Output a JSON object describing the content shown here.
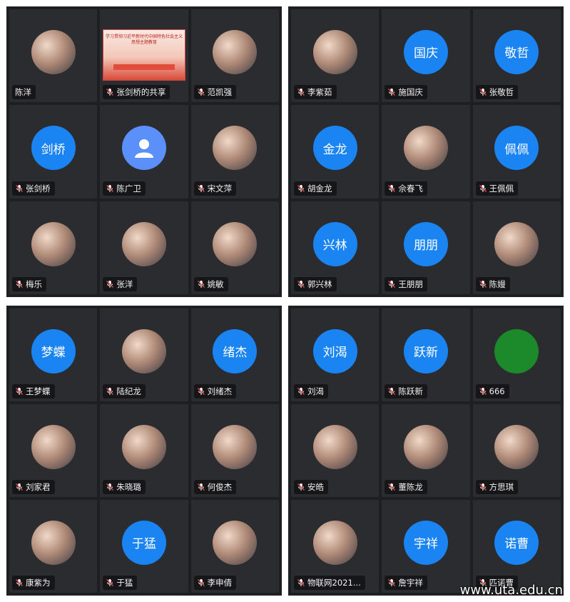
{
  "watermark": "www.uta.edu.cn",
  "colors": {
    "panel_bg": "#1e1f21",
    "tile_bg": "#2b2c2f",
    "avatar_blue": "#1a84f2",
    "mic_muted_red": "#e0443e"
  },
  "shared_screen": {
    "title": "学习贯彻习近平新时代中国特色社会主义思想主题教育"
  },
  "panels": [
    {
      "tiles": [
        {
          "name": "陈洋",
          "avatar": "photo",
          "muted": false
        },
        {
          "name": "张剑桥的共享",
          "avatar": "shared",
          "muted": true
        },
        {
          "name": "范凯强",
          "avatar": "photo",
          "muted": true
        },
        {
          "name": "张剑桥",
          "avatar": "text",
          "avatar_text": "剑桥",
          "muted": true
        },
        {
          "name": "陈广卫",
          "avatar": "default",
          "muted": true
        },
        {
          "name": "宋文萍",
          "avatar": "photo",
          "muted": true
        },
        {
          "name": "梅乐",
          "avatar": "photo",
          "muted": true
        },
        {
          "name": "张洋",
          "avatar": "photo",
          "muted": true
        },
        {
          "name": "姚敏",
          "avatar": "photo",
          "muted": true
        }
      ]
    },
    {
      "tiles": [
        {
          "name": "李紫茹",
          "avatar": "photo",
          "muted": true
        },
        {
          "name": "施国庆",
          "avatar": "text",
          "avatar_text": "国庆",
          "muted": true
        },
        {
          "name": "张敬哲",
          "avatar": "text",
          "avatar_text": "敬哲",
          "muted": true
        },
        {
          "name": "胡金龙",
          "avatar": "text",
          "avatar_text": "金龙",
          "muted": true
        },
        {
          "name": "佘春飞",
          "avatar": "photo",
          "muted": true
        },
        {
          "name": "王佩佩",
          "avatar": "text",
          "avatar_text": "佩佩",
          "muted": true
        },
        {
          "name": "郭兴林",
          "avatar": "text",
          "avatar_text": "兴林",
          "muted": true
        },
        {
          "name": "王朋朋",
          "avatar": "text",
          "avatar_text": "朋朋",
          "muted": true
        },
        {
          "name": "陈嫚",
          "avatar": "photo",
          "muted": true
        }
      ]
    },
    {
      "tiles": [
        {
          "name": "王梦蝶",
          "avatar": "text",
          "avatar_text": "梦蝶",
          "muted": true
        },
        {
          "name": "陆纪龙",
          "avatar": "photo",
          "muted": true
        },
        {
          "name": "刘绪杰",
          "avatar": "text",
          "avatar_text": "绪杰",
          "muted": true
        },
        {
          "name": "刘家君",
          "avatar": "photo",
          "muted": true
        },
        {
          "name": "朱晓璐",
          "avatar": "photo",
          "muted": true
        },
        {
          "name": "何俊杰",
          "avatar": "photo",
          "muted": true
        },
        {
          "name": "康紫为",
          "avatar": "photo",
          "muted": true
        },
        {
          "name": "于猛",
          "avatar": "text",
          "avatar_text": "于猛",
          "muted": true
        },
        {
          "name": "李申倩",
          "avatar": "photo",
          "muted": true
        }
      ]
    },
    {
      "tiles": [
        {
          "name": "刘渴",
          "avatar": "text",
          "avatar_text": "刘渴",
          "muted": true
        },
        {
          "name": "陈跃新",
          "avatar": "text",
          "avatar_text": "跃新",
          "muted": true
        },
        {
          "name": "666",
          "avatar": "green",
          "muted": true
        },
        {
          "name": "安皓",
          "avatar": "photo",
          "muted": true
        },
        {
          "name": "董陈龙",
          "avatar": "photo",
          "muted": true
        },
        {
          "name": "方思琪",
          "avatar": "photo",
          "muted": true
        },
        {
          "name": "物联网2021...",
          "avatar": "photo",
          "muted": true
        },
        {
          "name": "詹宇祥",
          "avatar": "text",
          "avatar_text": "宇祥",
          "muted": true
        },
        {
          "name": "匹诺曹",
          "avatar": "text",
          "avatar_text": "诺曹",
          "muted": true
        }
      ]
    }
  ]
}
